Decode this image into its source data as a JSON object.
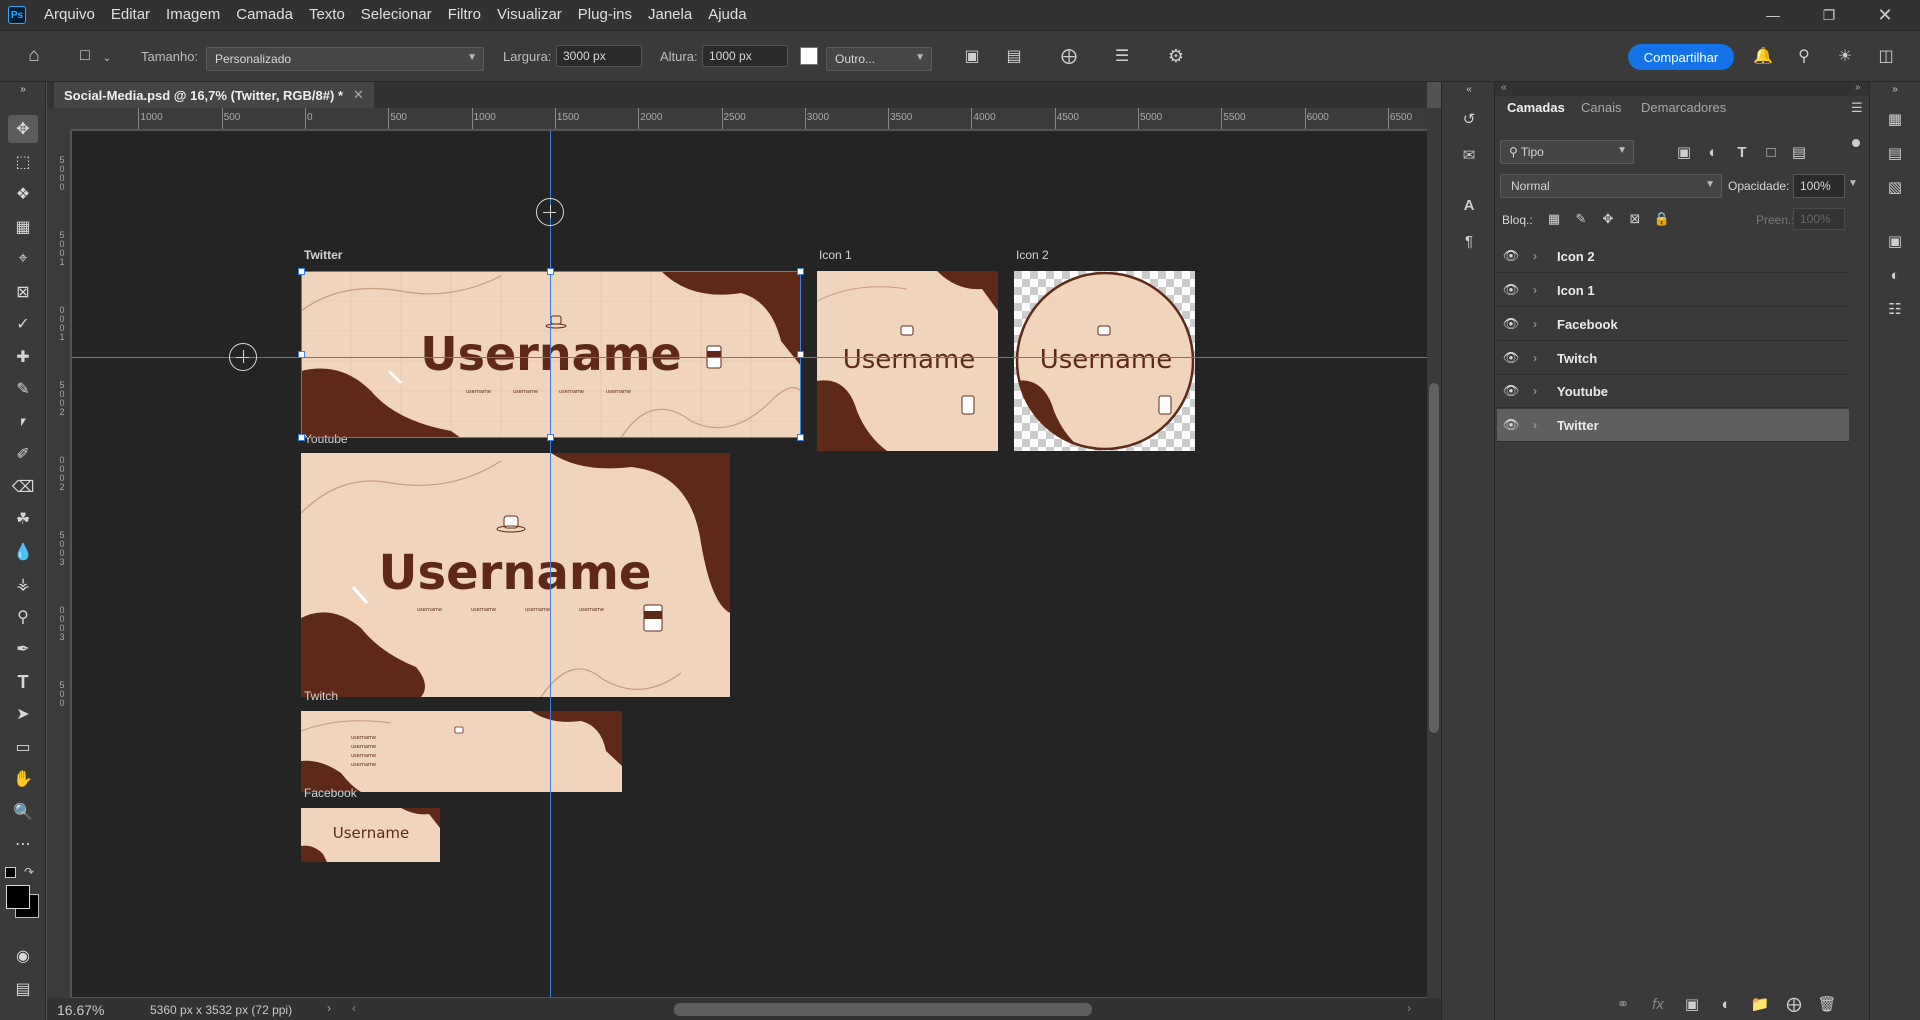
{
  "menubar": {
    "logo": "Ps",
    "items": [
      "Arquivo",
      "Editar",
      "Imagem",
      "Camada",
      "Texto",
      "Selecionar",
      "Filtro",
      "Visualizar",
      "Plug-ins",
      "Janela",
      "Ajuda"
    ]
  },
  "options": {
    "size_label": "Tamanho:",
    "size_value": "Personalizado",
    "width_label": "Largura:",
    "width_value": "3000 px",
    "height_label": "Altura:",
    "height_value": "1000 px",
    "other_value": "Outro...",
    "share_label": "Compartilhar"
  },
  "document": {
    "tab_title": "Social-Media.psd @ 16,7% (Twitter, RGB/8#) *",
    "zoom": "16.67%",
    "doc_info": "5360 px x 3532 px (72 ppi)"
  },
  "ruler_top": [
    "1000",
    "500",
    "0",
    "500",
    "1000",
    "1500",
    "2000",
    "2500",
    "3000",
    "3500",
    "4000",
    "4500",
    "5000",
    "5500",
    "6000",
    "6500"
  ],
  "ruler_left": [
    "5",
    "0",
    "0",
    "0",
    "5",
    "0",
    "0",
    "1",
    "0",
    "0",
    "0",
    "1",
    "5",
    "0",
    "0",
    "2",
    "0",
    "0",
    "0",
    "2",
    "5",
    "0",
    "0",
    "3",
    "0",
    "0",
    "0",
    "3",
    "5",
    "0",
    "0"
  ],
  "artboards": {
    "twitter": {
      "label": "Twitter",
      "username": "Username",
      "handle": "username"
    },
    "youtube": {
      "label": "Youtube",
      "username": "Username",
      "handle": "username"
    },
    "twitch": {
      "label": "Twitch",
      "handle": "username"
    },
    "facebook": {
      "label": "Facebook",
      "username": "Username"
    },
    "icon1": {
      "label": "Icon 1",
      "username": "Username"
    },
    "icon2": {
      "label": "Icon 2",
      "username": "Username"
    }
  },
  "panel": {
    "tabs": [
      "Camadas",
      "Canais",
      "Demarcadores"
    ],
    "filter": "Tipo",
    "blend_mode": "Normal",
    "opacity_label": "Opacidade:",
    "opacity_value": "100%",
    "lock_label": "Bloq.:",
    "fill_label": "Preen.:",
    "fill_value": "100%",
    "layers": [
      "Icon 2",
      "Icon 1",
      "Facebook",
      "Twitch",
      "Youtube",
      "Twitter"
    ]
  },
  "colors": {
    "banner_bg": "#f0d4bc",
    "banner_dark": "#5e2a17",
    "banner_line": "#c89c80",
    "guide": "#3d7fe0",
    "accent": "#1473e6"
  }
}
